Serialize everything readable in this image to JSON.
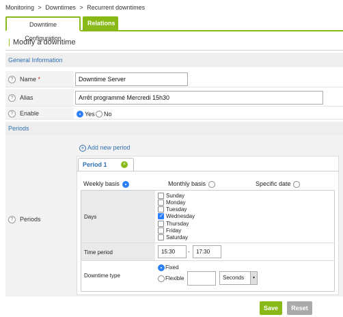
{
  "breadcrumb": [
    "Monitoring",
    ">",
    "Downtimes",
    ">",
    "Recurrent downtimes"
  ],
  "tabs": {
    "config": "Downtime Configuration",
    "relations": "Relations"
  },
  "page_title": "Modify a downtime",
  "sections": {
    "general": "General Information",
    "periods": "Periods"
  },
  "fields": {
    "help": "?",
    "name": {
      "label": "Name",
      "required": "*",
      "value": "Downtime Server"
    },
    "alias": {
      "label": "Alias",
      "value": "Arrêt programmé Mercredi 15h30"
    },
    "enable": {
      "label": "Enable",
      "yes": "Yes",
      "no": "No",
      "selected": "Yes"
    }
  },
  "periods": {
    "label": "Periods",
    "add_new": "Add new period",
    "add_icon": "+",
    "tab_label": "Period 1",
    "close_icon": "×",
    "basis": {
      "weekly": "Weekly basis",
      "monthly": "Monthly basis",
      "specific": "Specific date",
      "selected": "weekly"
    },
    "days_label": "Days",
    "days": [
      {
        "name": "Sunday",
        "checked": false
      },
      {
        "name": "Monday",
        "checked": false
      },
      {
        "name": "Tuesday",
        "checked": false
      },
      {
        "name": "Wednesday",
        "checked": true
      },
      {
        "name": "Thursday",
        "checked": false
      },
      {
        "name": "Friday",
        "checked": false
      },
      {
        "name": "Saturday",
        "checked": false
      }
    ],
    "time_period_label": "Time period",
    "time_from": "15:30",
    "time_sep": "-",
    "time_to": "17:30",
    "downtime_type_label": "Downtime type",
    "fixed": "Fixed",
    "flexible": "Flexible",
    "selected_type": "fixed",
    "duration_value": "",
    "duration_unit": "Seconds",
    "dropdown_icon": "▾"
  },
  "buttons": {
    "save": "Save",
    "reset": "Reset"
  },
  "colors": {
    "accent": "#88b917",
    "link": "#2f6fb0",
    "radio_on": "#2d7ff9",
    "required": "#c0282d"
  }
}
